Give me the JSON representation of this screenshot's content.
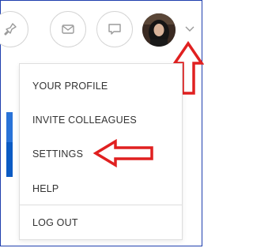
{
  "topbar": {
    "buttons": [
      {
        "icon": "pin-icon"
      },
      {
        "icon": "mail-icon"
      },
      {
        "icon": "chat-icon"
      }
    ],
    "avatar": {
      "icon": "user-avatar"
    },
    "dropdown_toggle": {
      "icon": "chevron-down-icon"
    }
  },
  "menu": {
    "items": [
      {
        "label": "YOUR PROFILE"
      },
      {
        "label": "INVITE COLLEAGUES"
      },
      {
        "label": "SETTINGS"
      },
      {
        "label": "HELP"
      }
    ],
    "logout_label": "LOG OUT"
  },
  "annotations": {
    "arrow_color": "#e02020"
  }
}
